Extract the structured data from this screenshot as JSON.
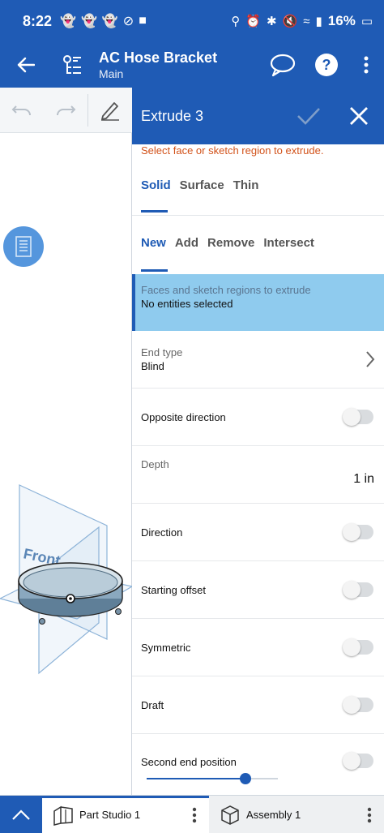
{
  "status_bar": {
    "time": "8:22",
    "battery": "16%",
    "colors": {
      "background": "#1f5bb5"
    }
  },
  "header": {
    "title": "AC Hose Bracket",
    "subtitle": "Main"
  },
  "viewport": {
    "plane_label": "Front"
  },
  "panel": {
    "title": "Extrude 3",
    "hint": "Select face or sketch region to extrude.",
    "body_tabs": [
      "Solid",
      "Surface",
      "Thin"
    ],
    "body_tab_active": "Solid",
    "op_tabs": [
      "New",
      "Add",
      "Remove",
      "Intersect"
    ],
    "op_tab_active": "New",
    "selection": {
      "label": "Faces and sketch regions to extrude",
      "value": "No entities selected"
    },
    "end_type": {
      "label": "End type",
      "value": "Blind"
    },
    "opposite_direction": {
      "label": "Opposite direction",
      "on": false
    },
    "depth": {
      "label": "Depth",
      "value": "1 in"
    },
    "direction": {
      "label": "Direction",
      "on": false
    },
    "starting_offset": {
      "label": "Starting offset",
      "on": false
    },
    "symmetric": {
      "label": "Symmetric",
      "on": false
    },
    "draft": {
      "label": "Draft",
      "on": false
    },
    "second_end_position": {
      "label": "Second end position",
      "on": false
    },
    "scroll_position": 0.75
  },
  "bottom_tabs": [
    {
      "label": "Part Studio 1",
      "active": true
    },
    {
      "label": "Assembly 1",
      "active": false
    }
  ],
  "colors": {
    "accent": "#1f5bb5",
    "selection": "#8fcbee",
    "hint": "#d2521a"
  }
}
